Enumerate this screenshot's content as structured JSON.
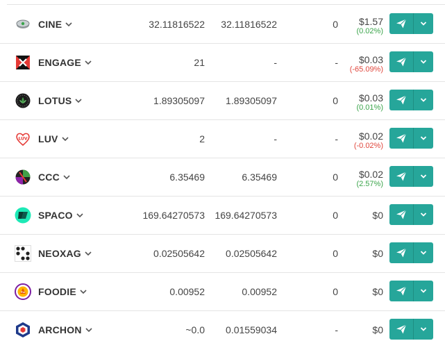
{
  "colors": {
    "accent": "#26a69a",
    "positive": "#3aa44a",
    "negative": "#e0463c"
  },
  "icons": {
    "send": "paper-plane-icon",
    "menu": "chevron-down-icon",
    "expand": "chevron-down-icon"
  },
  "rows": [
    {
      "token": "CINE",
      "logo": "cine-logo",
      "balance": "32.11816522",
      "available": "32.11816522",
      "staked": "0",
      "price": "$1.57",
      "change": "(0.02%)",
      "change_dir": "up"
    },
    {
      "token": "ENGAGE",
      "logo": "engage-logo",
      "balance": "21",
      "available": "-",
      "staked": "-",
      "price": "$0.03",
      "change": "(-65.09%)",
      "change_dir": "down"
    },
    {
      "token": "LOTUS",
      "logo": "lotus-logo",
      "balance": "1.89305097",
      "available": "1.89305097",
      "staked": "0",
      "price": "$0.03",
      "change": "(0.01%)",
      "change_dir": "up"
    },
    {
      "token": "LUV",
      "logo": "luv-logo",
      "balance": "2",
      "available": "-",
      "staked": "-",
      "price": "$0.02",
      "change": "(-0.02%)",
      "change_dir": "down"
    },
    {
      "token": "CCC",
      "logo": "ccc-logo",
      "balance": "6.35469",
      "available": "6.35469",
      "staked": "0",
      "price": "$0.02",
      "change": "(2.57%)",
      "change_dir": "up"
    },
    {
      "token": "SPACO",
      "logo": "spaco-logo",
      "balance": "169.64270573",
      "available": "169.64270573",
      "staked": "0",
      "price": "$0",
      "change": "",
      "change_dir": ""
    },
    {
      "token": "NEOXAG",
      "logo": "neoxag-logo",
      "balance": "0.02505642",
      "available": "0.02505642",
      "staked": "0",
      "price": "$0",
      "change": "",
      "change_dir": ""
    },
    {
      "token": "FOODIE",
      "logo": "foodie-logo",
      "balance": "0.00952",
      "available": "0.00952",
      "staked": "0",
      "price": "$0",
      "change": "",
      "change_dir": ""
    },
    {
      "token": "ARCHON",
      "logo": "archon-logo",
      "balance": "~0.0",
      "available": "0.01559034",
      "staked": "-",
      "price": "$0",
      "change": "",
      "change_dir": ""
    }
  ]
}
